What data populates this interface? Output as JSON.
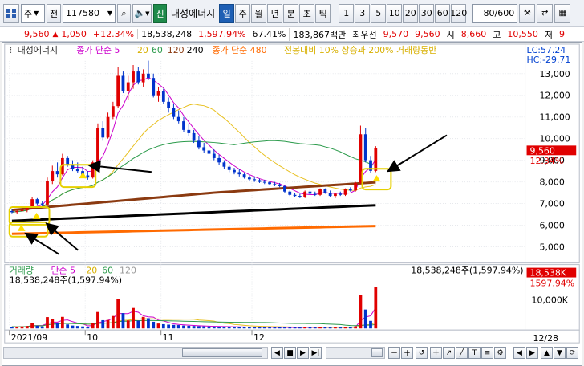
{
  "toolbar": {
    "market": "주",
    "code_prefix": "전",
    "code": "117580",
    "company": "대성에너지",
    "badge": "신",
    "periods": [
      "일",
      "주",
      "월",
      "년",
      "분",
      "초",
      "틱"
    ],
    "active_period": "일",
    "intervals": [
      "1",
      "3",
      "5",
      "10",
      "20",
      "30",
      "60",
      "120"
    ],
    "count": "80/600"
  },
  "quote": {
    "price": "9,560",
    "change": "1,050",
    "change_pct": "+12.34%",
    "volume": "18,538,248",
    "volume_pct": "1,597.94%",
    "strength": "67.41%",
    "amount": "183,867백만",
    "best_ask_label": "최우선",
    "best_ask": "9,570",
    "best_bid": "9,560",
    "open_label": "시",
    "open": "8,660",
    "high_label": "고",
    "high": "10,550",
    "low_label": "저",
    "low": "9"
  },
  "legend": {
    "name": "대성에너지",
    "ma_label": "종가 단순 5",
    "ma20": "20",
    "ma60": "60",
    "ma120": "120",
    "ma240": "240",
    "ma480": "종가 단순 480",
    "condition": "전봉대비 10% 상승과 200% 거래량동반"
  },
  "price_axis": {
    "ticks": [
      "13,000",
      "12,000",
      "11,000",
      "10,000",
      "9,000",
      "8,000",
      "7,000",
      "6,000",
      "5,000"
    ],
    "lc": "LC:57.24",
    "hc": "HC:-29.71",
    "cur_price": "9,560",
    "cur_pct": "12.34%"
  },
  "volume_panel": {
    "title": "거래량",
    "ma_label": "단순 5",
    "ma20": "20",
    "ma60": "60",
    "ma120": "120",
    "value_left": "18,538,248주(1,597.94%)",
    "value_right": "18,538,248주(1,597.94%)",
    "axis_tick": "10,000K",
    "badge": "18,538K",
    "badge_pct": "1597.94%"
  },
  "time_axis": {
    "labels": [
      "2021/09",
      "10",
      "11",
      "12"
    ],
    "end_date": "12/28"
  },
  "colors": {
    "up": "#e00000",
    "down": "#0033cc",
    "ma5": "#cc00cc",
    "ma20": "#e8c020",
    "ma60": "#2a9a4a",
    "ma120": "#8b3a10",
    "ma240": "#000000",
    "ma480": "#ff6a00"
  },
  "chart_data": {
    "type": "candlestick",
    "price_range": [
      4400,
      13700
    ],
    "volume_max_k": 19000,
    "candles": [
      [
        6650,
        6720,
        6550,
        6600
      ],
      [
        6600,
        6700,
        6500,
        6650
      ],
      [
        6650,
        6780,
        6550,
        6700
      ],
      [
        6700,
        6850,
        6600,
        6800
      ],
      [
        6800,
        7300,
        6750,
        7200
      ],
      [
        7200,
        7250,
        6900,
        7000
      ],
      [
        7000,
        7100,
        6850,
        6950
      ],
      [
        6950,
        8200,
        6900,
        8050
      ],
      [
        8050,
        8750,
        7900,
        8500
      ],
      [
        8500,
        8900,
        8200,
        8350
      ],
      [
        8350,
        9300,
        8300,
        9100
      ],
      [
        9100,
        9200,
        8700,
        8800
      ],
      [
        8800,
        9000,
        8500,
        8600
      ],
      [
        8600,
        8900,
        8400,
        8500
      ],
      [
        8500,
        8700,
        8250,
        8300
      ],
      [
        8300,
        8500,
        8100,
        8200
      ],
      [
        8200,
        9000,
        8150,
        8900
      ],
      [
        8900,
        10700,
        8850,
        10500
      ],
      [
        10500,
        10800,
        9900,
        10050
      ],
      [
        10050,
        11200,
        10000,
        11000
      ],
      [
        11000,
        11700,
        10900,
        11500
      ],
      [
        11500,
        13300,
        11400,
        12900
      ],
      [
        12900,
        13100,
        12100,
        12200
      ],
      [
        12200,
        12900,
        11800,
        12600
      ],
      [
        12600,
        13400,
        12300,
        13100
      ],
      [
        13100,
        13300,
        12500,
        12600
      ],
      [
        12600,
        13200,
        12400,
        13000
      ],
      [
        13000,
        13600,
        12700,
        12800
      ],
      [
        12800,
        13000,
        11900,
        12000
      ],
      [
        12000,
        12400,
        11700,
        12200
      ],
      [
        12200,
        12300,
        11600,
        11700
      ],
      [
        11700,
        11900,
        11200,
        11400
      ],
      [
        11400,
        11600,
        10900,
        11000
      ],
      [
        11000,
        11300,
        10700,
        10800
      ],
      [
        10800,
        11000,
        10300,
        10400
      ],
      [
        10400,
        10700,
        10100,
        10250
      ],
      [
        10250,
        10400,
        9800,
        9900
      ],
      [
        9900,
        10100,
        9500,
        9600
      ],
      [
        9600,
        9800,
        9350,
        9450
      ],
      [
        9450,
        9600,
        9200,
        9300
      ],
      [
        9300,
        9500,
        9000,
        9100
      ],
      [
        9100,
        9250,
        8800,
        8900
      ],
      [
        8900,
        9000,
        8600,
        8700
      ],
      [
        8700,
        8800,
        8450,
        8550
      ],
      [
        8550,
        8650,
        8350,
        8450
      ],
      [
        8450,
        8600,
        8250,
        8350
      ],
      [
        8350,
        8400,
        8150,
        8200
      ],
      [
        8200,
        8300,
        8050,
        8120
      ],
      [
        8120,
        8250,
        8000,
        8080
      ],
      [
        8080,
        8150,
        7950,
        8000
      ],
      [
        8000,
        8100,
        7900,
        7980
      ],
      [
        7980,
        8050,
        7850,
        7900
      ],
      [
        7900,
        8000,
        7800,
        7850
      ],
      [
        7850,
        7950,
        7750,
        7800
      ],
      [
        7800,
        7850,
        7500,
        7550
      ],
      [
        7550,
        7600,
        7350,
        7400
      ],
      [
        7400,
        7500,
        7300,
        7350
      ],
      [
        7350,
        7450,
        7250,
        7300
      ],
      [
        7300,
        7600,
        7250,
        7550
      ],
      [
        7550,
        7650,
        7400,
        7450
      ],
      [
        7450,
        7550,
        7350,
        7400
      ],
      [
        7400,
        7700,
        7350,
        7650
      ],
      [
        7650,
        7700,
        7450,
        7500
      ],
      [
        7500,
        7600,
        7300,
        7350
      ],
      [
        7350,
        7500,
        7250,
        7450
      ],
      [
        7450,
        7550,
        7350,
        7400
      ],
      [
        7400,
        7700,
        7350,
        7650
      ],
      [
        7650,
        7750,
        7550,
        7600
      ],
      [
        7600,
        8000,
        7550,
        7950
      ],
      [
        7950,
        10600,
        7900,
        10200
      ],
      [
        10200,
        10500,
        8900,
        9000
      ],
      [
        9000,
        9200,
        8400,
        8510
      ],
      [
        8510,
        9650,
        8450,
        9560
      ]
    ],
    "volume_k": [
      800,
      600,
      900,
      1100,
      2600,
      1200,
      900,
      5100,
      4300,
      2600,
      5200,
      1800,
      1300,
      1100,
      900,
      800,
      2400,
      7400,
      3700,
      3800,
      5600,
      13300,
      6900,
      3600,
      9200,
      3500,
      5200,
      4600,
      3000,
      2200,
      1900,
      1700,
      1600,
      1500,
      1300,
      1200,
      1100,
      1000,
      950,
      900,
      850,
      800,
      750,
      700,
      650,
      600,
      580,
      560,
      540,
      520,
      500,
      480,
      460,
      450,
      430,
      420,
      410,
      400,
      600,
      450,
      420,
      580,
      440,
      400,
      420,
      410,
      560,
      450,
      900,
      15200,
      8500,
      3400,
      18538
    ]
  }
}
